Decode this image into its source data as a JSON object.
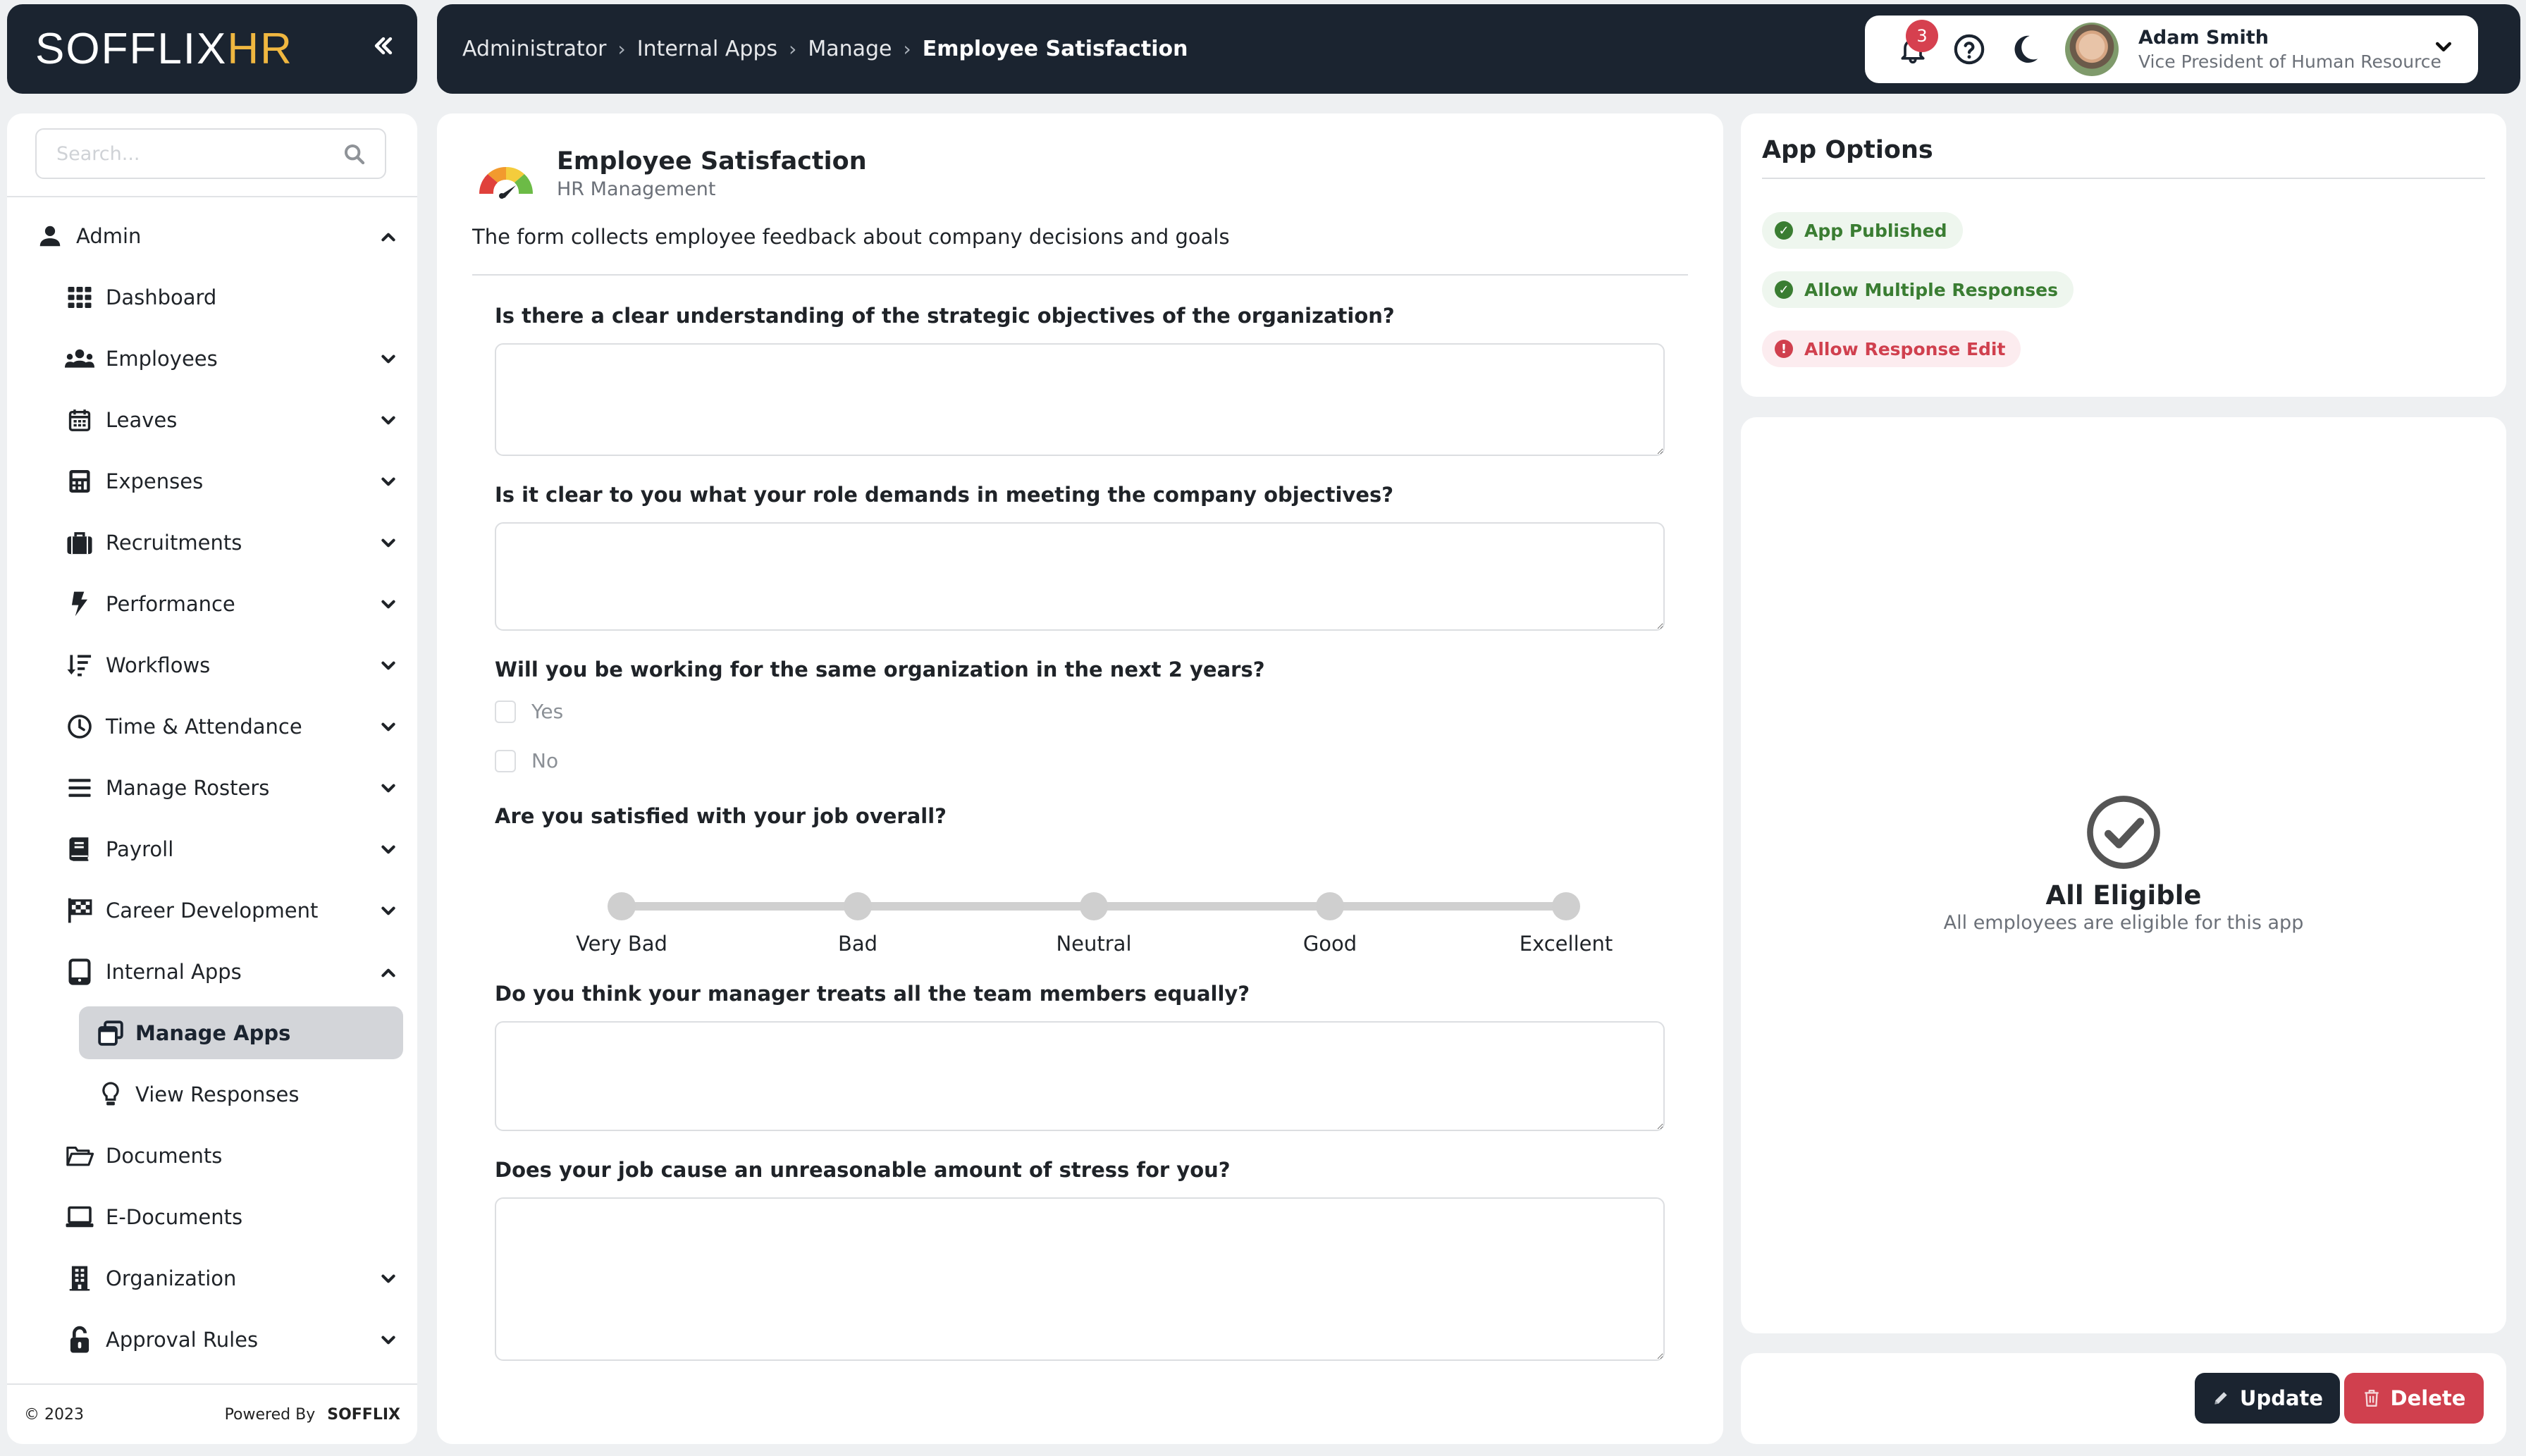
{
  "brand": {
    "logo_main": "SOFFLIX",
    "logo_accent": "HR",
    "accent_color": "#f0b740",
    "collapse_icon": "double-chevron-left"
  },
  "breadcrumb": [
    {
      "label": "Administrator"
    },
    {
      "label": "Internal Apps"
    },
    {
      "label": "Manage"
    },
    {
      "label": "Employee Satisfaction"
    }
  ],
  "header": {
    "notifications_count": "3",
    "icons": [
      "bell-icon",
      "help-icon",
      "moon-icon"
    ],
    "user": {
      "name": "Adam Smith",
      "role": "Vice President of Human Resource"
    }
  },
  "sidebar": {
    "search_placeholder": "Search...",
    "items": [
      {
        "label": "Admin",
        "icon": "user-icon",
        "level": 0,
        "chevron": "up"
      },
      {
        "label": "Dashboard",
        "icon": "grid-icon",
        "level": 1,
        "chevron": ""
      },
      {
        "label": "Employees",
        "icon": "users-icon",
        "level": 1,
        "chevron": "down"
      },
      {
        "label": "Leaves",
        "icon": "calendar-icon",
        "level": 1,
        "chevron": "down"
      },
      {
        "label": "Expenses",
        "icon": "calculator-icon",
        "level": 1,
        "chevron": "down"
      },
      {
        "label": "Recruitments",
        "icon": "briefcase-icon",
        "level": 1,
        "chevron": "down"
      },
      {
        "label": "Performance",
        "icon": "bolt-icon",
        "level": 1,
        "chevron": "down"
      },
      {
        "label": "Workflows",
        "icon": "sort-icon",
        "level": 1,
        "chevron": "down"
      },
      {
        "label": "Time & Attendance",
        "icon": "clock-icon",
        "level": 1,
        "chevron": "down"
      },
      {
        "label": "Manage Rosters",
        "icon": "bars-icon",
        "level": 1,
        "chevron": "down"
      },
      {
        "label": "Payroll",
        "icon": "book-icon",
        "level": 1,
        "chevron": "down"
      },
      {
        "label": "Career Development",
        "icon": "flag-checkered-icon",
        "level": 1,
        "chevron": "down"
      },
      {
        "label": "Internal Apps",
        "icon": "tablet-icon",
        "level": 1,
        "chevron": "up"
      },
      {
        "label": "Manage Apps",
        "icon": "windows-icon",
        "level": 2,
        "chevron": "",
        "active": true
      },
      {
        "label": "View Responses",
        "icon": "lightbulb-icon",
        "level": 2,
        "chevron": ""
      },
      {
        "label": "Documents",
        "icon": "folder-open-icon",
        "level": 1,
        "chevron": ""
      },
      {
        "label": "E-Documents",
        "icon": "laptop-icon",
        "level": 1,
        "chevron": ""
      },
      {
        "label": "Organization",
        "icon": "building-icon",
        "level": 1,
        "chevron": "down"
      },
      {
        "label": "Approval Rules",
        "icon": "unlock-icon",
        "level": 1,
        "chevron": "down"
      }
    ],
    "footer": {
      "copyright": "© 2023",
      "powered_by": "Powered By",
      "powered_brand": "SOFFLIX"
    }
  },
  "app": {
    "title": "Employee Satisfaction",
    "category": "HR Management",
    "description": "The form collects employee feedback about company decisions and goals",
    "questions": [
      {
        "type": "textarea",
        "label": "Is there a clear understanding of the strategic objectives of the organization?",
        "value": ""
      },
      {
        "type": "textarea",
        "label": "Is it clear to you what your role demands in meeting the company objectives?",
        "value": ""
      },
      {
        "type": "checkbox",
        "label": "Will you be working for the same organization in the next 2 years?",
        "options": [
          {
            "label": "Yes",
            "checked": false
          },
          {
            "label": "No",
            "checked": false
          }
        ]
      },
      {
        "type": "rating",
        "label": "Are you satisfied with your job overall?",
        "options": [
          "Very Bad",
          "Bad",
          "Neutral",
          "Good",
          "Excellent"
        ],
        "selected": null
      },
      {
        "type": "textarea",
        "label": "Do you think your manager treats all the team members equally?",
        "value": ""
      },
      {
        "type": "textarea",
        "label": "Does your job cause an unreasonable amount of stress for you?",
        "value": ""
      }
    ]
  },
  "app_options": {
    "title": "App Options",
    "flags": [
      {
        "label": "App Published",
        "status": "enabled",
        "color": "#3a7d32"
      },
      {
        "label": "Allow Multiple Responses",
        "status": "enabled",
        "color": "#3a7d32"
      },
      {
        "label": "Allow Response Edit",
        "status": "disabled",
        "color": "#d0404e"
      }
    ]
  },
  "eligibility": {
    "title": "All Eligible",
    "subtitle": "All employees are eligible for this app"
  },
  "actions": {
    "update_label": "Update",
    "delete_label": "Delete",
    "update_color": "#1b2430",
    "delete_color": "#d0404e"
  }
}
